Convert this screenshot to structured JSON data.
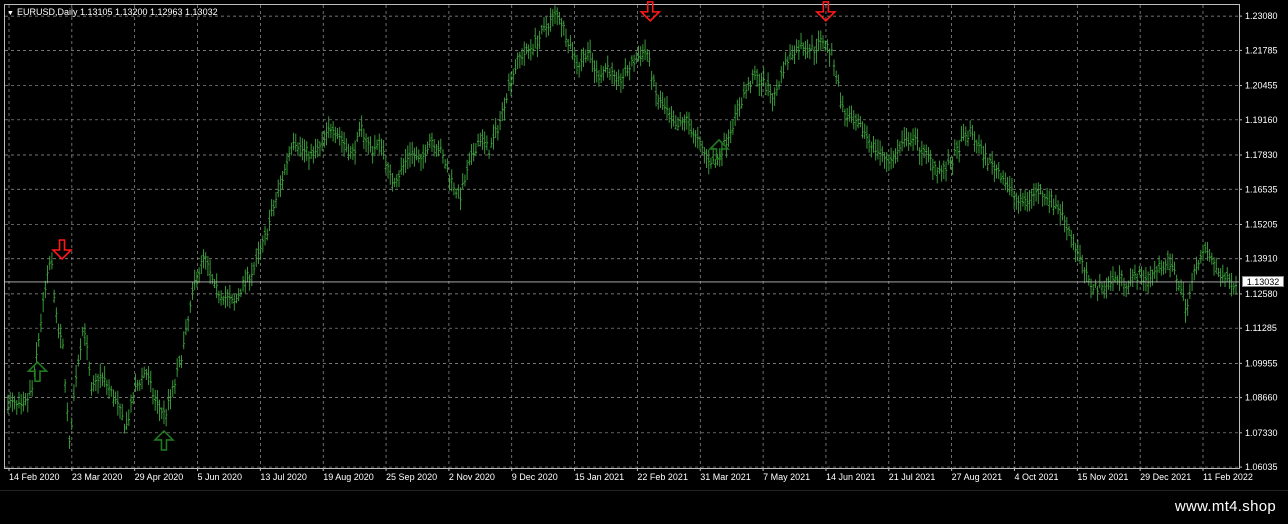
{
  "chart": {
    "symbol": "EURUSD",
    "timeframe": "Daily",
    "header_text": "EURUSD,Daily  1.13105 1.13200 1.12963 1.13032",
    "current_price": "1.13032",
    "colors": {
      "background": "#000000",
      "candles": "#3fa83f",
      "grid": "#9a9a9a",
      "sell_arrow": "#ff1a1a",
      "buy_arrow": "#1f7a1f",
      "price_line": "#bdbdbd"
    }
  },
  "chart_data": {
    "type": "bar",
    "series_name": "EURUSD",
    "y_ticks": [
      "1.23080",
      "1.21785",
      "1.20455",
      "1.19160",
      "1.17830",
      "1.16535",
      "1.15205",
      "1.13910",
      "1.12580",
      "1.11285",
      "1.09955",
      "1.08660",
      "1.07330",
      "1.06035"
    ],
    "ylim": [
      1.06,
      1.235
    ],
    "x_ticks": [
      "14 Feb 2020",
      "23 Mar 2020",
      "29 Apr 2020",
      "5 Jun 2020",
      "13 Jul 2020",
      "19 Aug 2020",
      "25 Sep 2020",
      "2 Nov 2020",
      "9 Dec 2020",
      "15 Jan 2021",
      "22 Feb 2021",
      "31 Mar 2021",
      "7 May 2021",
      "14 Jun 2021",
      "21 Jul 2021",
      "27 Aug 2021",
      "4 Oct 2021",
      "15 Nov 2021",
      "29 Dec 2021",
      "11 Feb 2022"
    ],
    "price_path": [
      [
        0,
        1.085
      ],
      [
        0.012,
        1.082
      ],
      [
        0.02,
        1.09
      ],
      [
        0.028,
        1.12
      ],
      [
        0.035,
        1.14
      ],
      [
        0.04,
        1.113
      ],
      [
        0.045,
        1.105
      ],
      [
        0.05,
        1.068
      ],
      [
        0.056,
        1.098
      ],
      [
        0.062,
        1.115
      ],
      [
        0.068,
        1.088
      ],
      [
        0.074,
        1.095
      ],
      [
        0.08,
        1.092
      ],
      [
        0.088,
        1.085
      ],
      [
        0.096,
        1.075
      ],
      [
        0.104,
        1.09
      ],
      [
        0.112,
        1.097
      ],
      [
        0.12,
        1.085
      ],
      [
        0.128,
        1.08
      ],
      [
        0.136,
        1.092
      ],
      [
        0.144,
        1.108
      ],
      [
        0.152,
        1.13
      ],
      [
        0.16,
        1.14
      ],
      [
        0.168,
        1.128
      ],
      [
        0.176,
        1.125
      ],
      [
        0.184,
        1.122
      ],
      [
        0.192,
        1.13
      ],
      [
        0.2,
        1.135
      ],
      [
        0.208,
        1.145
      ],
      [
        0.216,
        1.158
      ],
      [
        0.224,
        1.17
      ],
      [
        0.232,
        1.185
      ],
      [
        0.24,
        1.18
      ],
      [
        0.248,
        1.178
      ],
      [
        0.256,
        1.182
      ],
      [
        0.264,
        1.19
      ],
      [
        0.272,
        1.184
      ],
      [
        0.28,
        1.178
      ],
      [
        0.288,
        1.188
      ],
      [
        0.296,
        1.18
      ],
      [
        0.304,
        1.183
      ],
      [
        0.312,
        1.168
      ],
      [
        0.32,
        1.172
      ],
      [
        0.328,
        1.18
      ],
      [
        0.336,
        1.175
      ],
      [
        0.344,
        1.185
      ],
      [
        0.352,
        1.18
      ],
      [
        0.36,
        1.17
      ],
      [
        0.368,
        1.162
      ],
      [
        0.376,
        1.175
      ],
      [
        0.384,
        1.185
      ],
      [
        0.392,
        1.18
      ],
      [
        0.4,
        1.19
      ],
      [
        0.408,
        1.205
      ],
      [
        0.416,
        1.215
      ],
      [
        0.424,
        1.218
      ],
      [
        0.432,
        1.222
      ],
      [
        0.44,
        1.228
      ],
      [
        0.448,
        1.232
      ],
      [
        0.456,
        1.222
      ],
      [
        0.464,
        1.212
      ],
      [
        0.472,
        1.218
      ],
      [
        0.48,
        1.208
      ],
      [
        0.488,
        1.212
      ],
      [
        0.496,
        1.205
      ],
      [
        0.504,
        1.21
      ],
      [
        0.512,
        1.215
      ],
      [
        0.52,
        1.218
      ],
      [
        0.528,
        1.2
      ],
      [
        0.536,
        1.195
      ],
      [
        0.544,
        1.188
      ],
      [
        0.552,
        1.192
      ],
      [
        0.56,
        1.185
      ],
      [
        0.568,
        1.178
      ],
      [
        0.576,
        1.175
      ],
      [
        0.584,
        1.183
      ],
      [
        0.592,
        1.192
      ],
      [
        0.6,
        1.202
      ],
      [
        0.608,
        1.208
      ],
      [
        0.616,
        1.205
      ],
      [
        0.624,
        1.2
      ],
      [
        0.632,
        1.212
      ],
      [
        0.64,
        1.218
      ],
      [
        0.648,
        1.22
      ],
      [
        0.656,
        1.218
      ],
      [
        0.664,
        1.222
      ],
      [
        0.672,
        1.215
      ],
      [
        0.68,
        1.195
      ],
      [
        0.688,
        1.19
      ],
      [
        0.696,
        1.188
      ],
      [
        0.704,
        1.182
      ],
      [
        0.712,
        1.178
      ],
      [
        0.72,
        1.176
      ],
      [
        0.728,
        1.182
      ],
      [
        0.736,
        1.185
      ],
      [
        0.744,
        1.18
      ],
      [
        0.752,
        1.176
      ],
      [
        0.76,
        1.172
      ],
      [
        0.768,
        1.175
      ],
      [
        0.776,
        1.183
      ],
      [
        0.784,
        1.187
      ],
      [
        0.792,
        1.18
      ],
      [
        0.8,
        1.175
      ],
      [
        0.808,
        1.172
      ],
      [
        0.816,
        1.165
      ],
      [
        0.824,
        1.16
      ],
      [
        0.832,
        1.162
      ],
      [
        0.84,
        1.165
      ],
      [
        0.848,
        1.162
      ],
      [
        0.856,
        1.158
      ],
      [
        0.864,
        1.15
      ],
      [
        0.872,
        1.14
      ],
      [
        0.88,
        1.13
      ],
      [
        0.888,
        1.128
      ],
      [
        0.896,
        1.13
      ],
      [
        0.904,
        1.132
      ],
      [
        0.912,
        1.13
      ],
      [
        0.92,
        1.133
      ],
      [
        0.928,
        1.131
      ],
      [
        0.936,
        1.135
      ],
      [
        0.944,
        1.138
      ],
      [
        0.952,
        1.132
      ],
      [
        0.96,
        1.12
      ],
      [
        0.968,
        1.138
      ],
      [
        0.976,
        1.142
      ],
      [
        0.984,
        1.135
      ],
      [
        0.992,
        1.131
      ],
      [
        1.0,
        1.13
      ]
    ],
    "sell_signals": [
      [
        0.044,
        1.139
      ],
      [
        0.523,
        1.229
      ],
      [
        0.666,
        1.229
      ]
    ],
    "buy_signals": [
      [
        0.024,
        1.1
      ],
      [
        0.127,
        1.074
      ],
      [
        0.579,
        1.184
      ]
    ]
  },
  "footer": {
    "watermark": "www.mt4.shop"
  }
}
